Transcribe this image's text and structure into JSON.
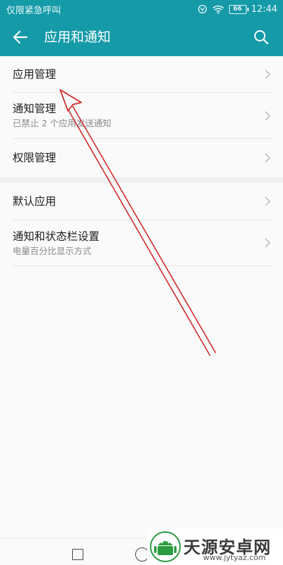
{
  "status_bar": {
    "carrier_text": "仅限紧急呼叫",
    "battery_level": "66",
    "time": "12:44"
  },
  "app_bar": {
    "title": "应用和通知"
  },
  "groups": [
    {
      "items": [
        {
          "title": "应用管理",
          "subtitle": ""
        },
        {
          "title": "通知管理",
          "subtitle": "已禁止 2 个应用发送通知"
        },
        {
          "title": "权限管理",
          "subtitle": ""
        }
      ]
    },
    {
      "items": [
        {
          "title": "默认应用",
          "subtitle": ""
        },
        {
          "title": "通知和状态栏设置",
          "subtitle": "电量百分比显示方式"
        }
      ]
    }
  ],
  "watermark": {
    "name": "天源安卓网",
    "url": "www.jytyaz.com"
  },
  "colors": {
    "accent": "#159aa8",
    "annotation_arrow": "#d22a2a"
  }
}
